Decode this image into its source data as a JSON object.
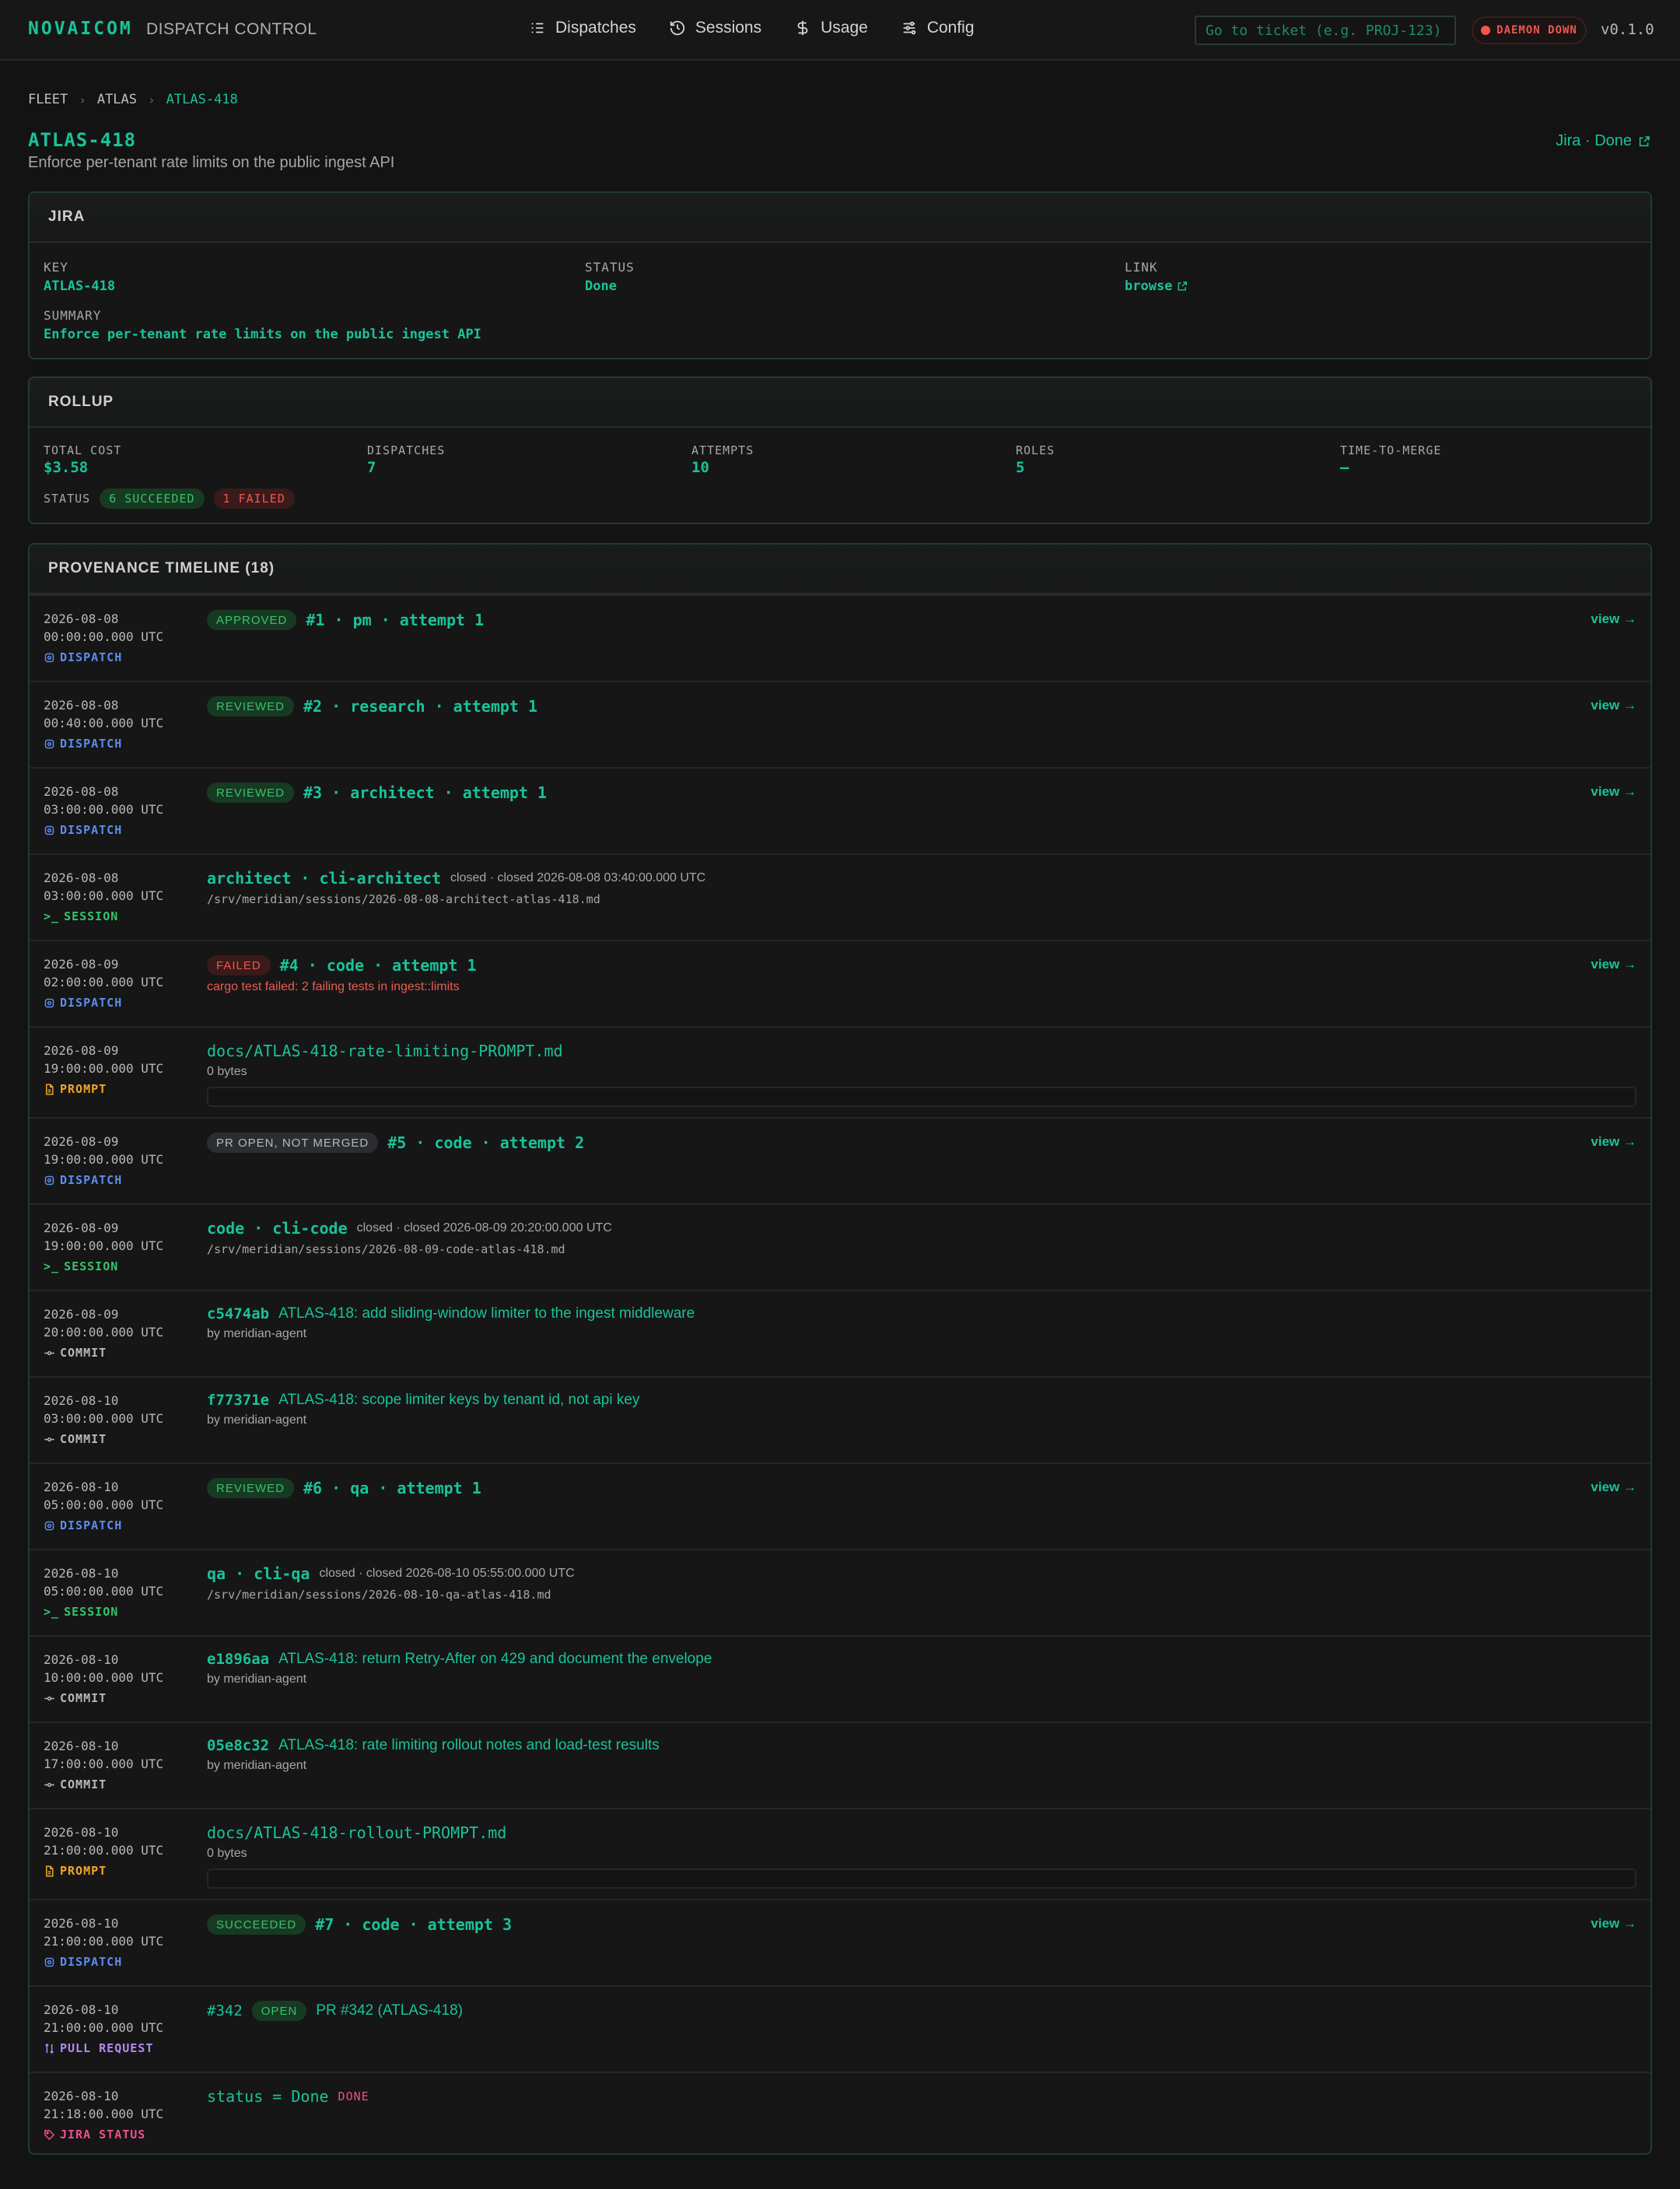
{
  "topbar": {
    "brand": "NOVAICOM",
    "brand_sub": "DISPATCH CONTROL",
    "nav": [
      {
        "label": "Dispatches",
        "icon": "list-icon"
      },
      {
        "label": "Sessions",
        "icon": "history-icon"
      },
      {
        "label": "Usage",
        "icon": "dollar-icon"
      },
      {
        "label": "Config",
        "icon": "sliders-icon"
      }
    ],
    "ticket_placeholder": "Go to ticket (e.g. PROJ-123)",
    "daemon_status": "DAEMON DOWN",
    "version": "v0.1.0"
  },
  "breadcrumb": [
    "FLEET",
    "ATLAS",
    "ATLAS-418"
  ],
  "header": {
    "title": "ATLAS-418",
    "subtitle": "Enforce per-tenant rate limits on the public ingest API",
    "jira_link": "Jira · Done"
  },
  "jira": {
    "heading": "JIRA",
    "key_label": "KEY",
    "key": "ATLAS-418",
    "status_label": "STATUS",
    "status": "Done",
    "link_label": "LINK",
    "link": "browse",
    "summary_label": "SUMMARY",
    "summary": "Enforce per-tenant rate limits on the public ingest API"
  },
  "rollup": {
    "heading": "ROLLUP",
    "stats": [
      {
        "label": "TOTAL COST",
        "value": "$3.58"
      },
      {
        "label": "DISPATCHES",
        "value": "7"
      },
      {
        "label": "ATTEMPTS",
        "value": "10"
      },
      {
        "label": "ROLES",
        "value": "5"
      },
      {
        "label": "TIME-TO-MERGE",
        "value": "—"
      }
    ],
    "status_label": "STATUS",
    "succeeded": "6 SUCCEEDED",
    "failed": "1 FAILED"
  },
  "timeline": {
    "heading": "PROVENANCE TIMELINE (18)",
    "view_label": "view →",
    "events": [
      {
        "date": "2026-08-08",
        "time": "00:00:00.000 UTC",
        "kind": "DISPATCH",
        "badge": "APPROVED",
        "title": "#1 · pm · attempt 1"
      },
      {
        "date": "2026-08-08",
        "time": "00:40:00.000 UTC",
        "kind": "DISPATCH",
        "badge": "REVIEWED",
        "title": "#2 · research · attempt 1"
      },
      {
        "date": "2026-08-08",
        "time": "03:00:00.000 UTC",
        "kind": "DISPATCH",
        "badge": "REVIEWED",
        "title": "#3 · architect · attempt 1"
      },
      {
        "date": "2026-08-08",
        "time": "03:00:00.000 UTC",
        "kind": "SESSION",
        "title": "architect · cli-architect",
        "meta": "closed · closed 2026-08-08 03:40:00.000 UTC",
        "path": "/srv/meridian/sessions/2026-08-08-architect-atlas-418.md"
      },
      {
        "date": "2026-08-09",
        "time": "02:00:00.000 UTC",
        "kind": "DISPATCH",
        "badge": "FAILED",
        "title": "#4 · code · attempt 1",
        "error": "cargo test failed: 2 failing tests in ingest::limits"
      },
      {
        "date": "2026-08-09",
        "time": "19:00:00.000 UTC",
        "kind": "PROMPT",
        "title": "docs/ATLAS-418-rate-limiting-PROMPT.md",
        "meta": "0 bytes"
      },
      {
        "date": "2026-08-09",
        "time": "19:00:00.000 UTC",
        "kind": "DISPATCH",
        "badge": "PR OPEN, NOT MERGED",
        "title": "#5 · code · attempt 2"
      },
      {
        "date": "2026-08-09",
        "time": "19:00:00.000 UTC",
        "kind": "SESSION",
        "title": "code · cli-code",
        "meta": "closed · closed 2026-08-09 20:20:00.000 UTC",
        "path": "/srv/meridian/sessions/2026-08-09-code-atlas-418.md"
      },
      {
        "date": "2026-08-09",
        "time": "20:00:00.000 UTC",
        "kind": "COMMIT",
        "sha": "c5474ab",
        "message": "ATLAS-418: add sliding-window limiter to the ingest middleware",
        "by": "by meridian-agent"
      },
      {
        "date": "2026-08-10",
        "time": "03:00:00.000 UTC",
        "kind": "COMMIT",
        "sha": "f77371e",
        "message": "ATLAS-418: scope limiter keys by tenant id, not api key",
        "by": "by meridian-agent"
      },
      {
        "date": "2026-08-10",
        "time": "05:00:00.000 UTC",
        "kind": "DISPATCH",
        "badge": "REVIEWED",
        "title": "#6 · qa · attempt 1"
      },
      {
        "date": "2026-08-10",
        "time": "05:00:00.000 UTC",
        "kind": "SESSION",
        "title": "qa · cli-qa",
        "meta": "closed · closed 2026-08-10 05:55:00.000 UTC",
        "path": "/srv/meridian/sessions/2026-08-10-qa-atlas-418.md"
      },
      {
        "date": "2026-08-10",
        "time": "10:00:00.000 UTC",
        "kind": "COMMIT",
        "sha": "e1896aa",
        "message": "ATLAS-418: return Retry-After on 429 and document the envelope",
        "by": "by meridian-agent"
      },
      {
        "date": "2026-08-10",
        "time": "17:00:00.000 UTC",
        "kind": "COMMIT",
        "sha": "05e8c32",
        "message": "ATLAS-418: rate limiting rollout notes and load-test results",
        "by": "by meridian-agent"
      },
      {
        "date": "2026-08-10",
        "time": "21:00:00.000 UTC",
        "kind": "PROMPT",
        "title": "docs/ATLAS-418-rollout-PROMPT.md",
        "meta": "0 bytes"
      },
      {
        "date": "2026-08-10",
        "time": "21:00:00.000 UTC",
        "kind": "DISPATCH",
        "badge": "SUCCEEDED",
        "title": "#7 · code · attempt 3"
      },
      {
        "date": "2026-08-10",
        "time": "21:00:00.000 UTC",
        "kind": "PULL REQUEST",
        "pr_number": "#342",
        "badge": "OPEN",
        "pr_title": "PR #342 (ATLAS-418)"
      },
      {
        "date": "2026-08-10",
        "time": "21:18:00.000 UTC",
        "kind": "JIRA STATUS",
        "title": "status = Done",
        "tag": "DONE"
      }
    ]
  },
  "colors": {
    "accent": "#19c39a",
    "background": "#131313",
    "dispatch": "#5b8dee",
    "session": "#36c36b",
    "prompt": "#f0a52a",
    "pull_request": "#b489f0",
    "jira_status": "#ee4f8d",
    "danger": "#f0564e"
  }
}
